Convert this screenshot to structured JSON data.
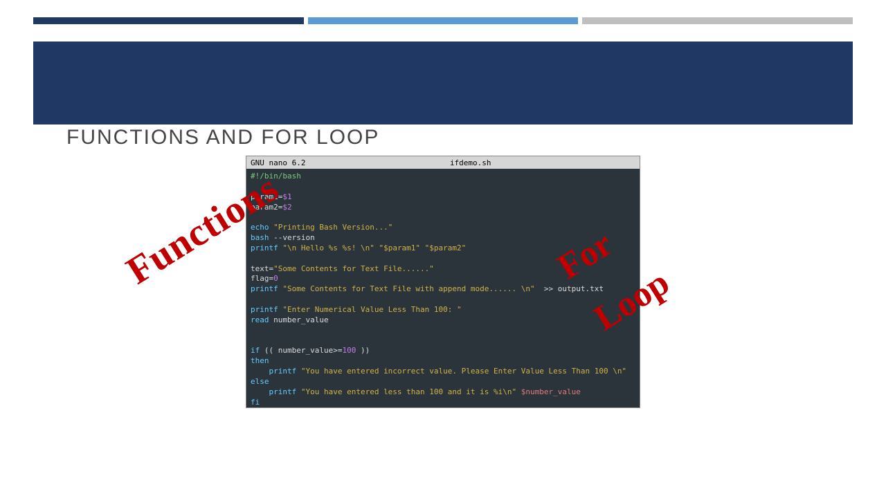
{
  "slide": {
    "title": "FUNCTIONS AND FOR LOOP"
  },
  "terminal": {
    "app": "GNU nano 6.2",
    "filename": "ifdemo.sh",
    "code": {
      "shebang": "#!/bin/bash",
      "p1_lhs": "param1",
      "p1_rhs": "$1",
      "p2_lhs": "param2",
      "p2_rhs": "$2",
      "echo": "echo",
      "echo_str": "\"Printing Bash Version...\"",
      "bash": "bash",
      "bash_arg": "--version",
      "printf1": "printf",
      "printf1_str": "\"\\n Hello %s %s! \\n\" \"$param1\" \"$param2\"",
      "text_lhs": "text",
      "text_rhs": "\"Some Contents for Text File......\"",
      "flag_lhs": "flag",
      "flag_rhs": "0",
      "printf2": "printf",
      "printf2_str": "\"Some Contents for Text File with append mode...... \\n\"",
      "redir": "  >> ",
      "outfile": "output.txt",
      "printf3": "printf",
      "printf3_str": "\"Enter Numerical Value Less Than 100: \"",
      "read": "read",
      "read_var": " number_value",
      "if": "if",
      "cond_open": " (( ",
      "cond_var": "number_value",
      "cond_op": ">=",
      "cond_num": "100",
      "cond_close": " ))",
      "then": "then",
      "printf4": "    printf",
      "printf4_str": " \"You have entered incorrect value. Please Enter Value Less Than 100 \\n\"",
      "else": "else",
      "printf5": "    printf",
      "printf5_str": " \"You have entered less than 100 and it is %i\\n\"",
      "printf5_var": " $number_value",
      "fi": "fi"
    }
  },
  "overlays": {
    "functions": "Functions",
    "for": "For",
    "loop": "Loop"
  }
}
